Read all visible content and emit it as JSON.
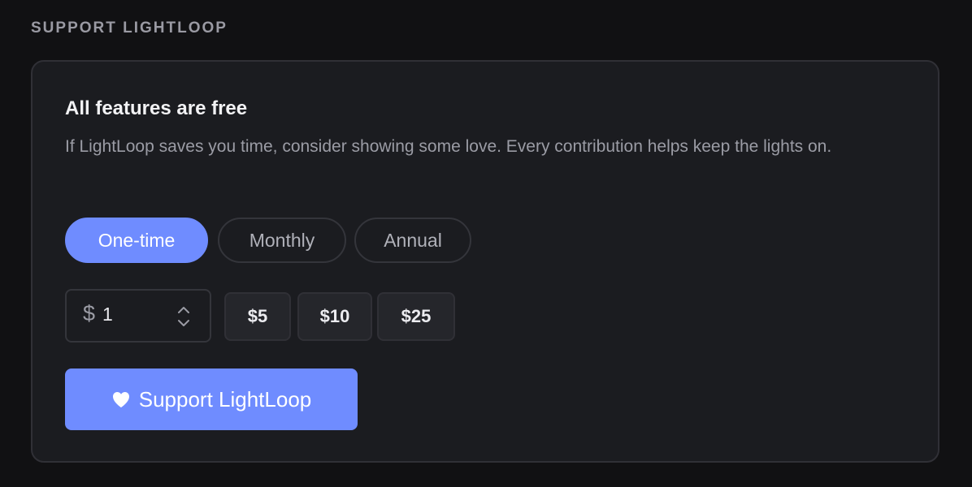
{
  "section": {
    "label": "SUPPORT LIGHTLOOP"
  },
  "card": {
    "title": "All features are free",
    "description": "If LightLoop saves you time, consider showing some love. Every contribution helps keep the lights on."
  },
  "frequency": {
    "options": [
      {
        "label": "One-time",
        "selected": true
      },
      {
        "label": "Monthly",
        "selected": false
      },
      {
        "label": "Annual",
        "selected": false
      }
    ]
  },
  "amount": {
    "currency_symbol": "$",
    "value": "1",
    "presets": [
      "$5",
      "$10",
      "$25"
    ]
  },
  "submit": {
    "label": "Support LightLoop",
    "icon": "heart-icon"
  },
  "colors": {
    "accent": "#6f8cff",
    "background": "#111113",
    "card": "#1b1c20"
  }
}
